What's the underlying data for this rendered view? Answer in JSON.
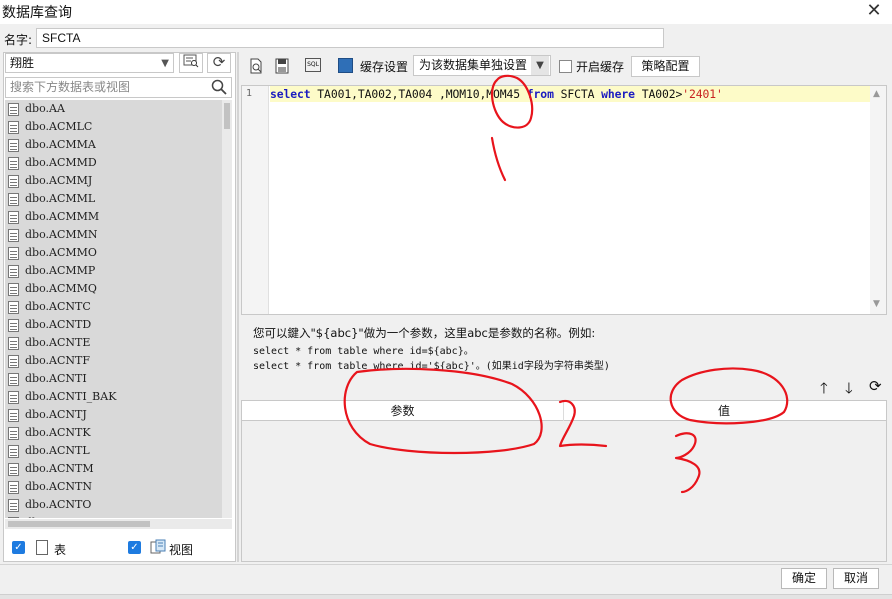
{
  "window": {
    "title": "数据库查询",
    "close_glyph": "✕"
  },
  "name_row": {
    "label": "名字:",
    "value": "SFCTA"
  },
  "left": {
    "datasource": "翔胜",
    "search_placeholder": "搜索下方数据表或视图",
    "tables": [
      "dbo.AA",
      "dbo.ACMLC",
      "dbo.ACMMA",
      "dbo.ACMMD",
      "dbo.ACMMJ",
      "dbo.ACMML",
      "dbo.ACMMM",
      "dbo.ACMMN",
      "dbo.ACMMO",
      "dbo.ACMMP",
      "dbo.ACMMQ",
      "dbo.ACNTC",
      "dbo.ACNTD",
      "dbo.ACNTE",
      "dbo.ACNTF",
      "dbo.ACNTI",
      "dbo.ACNTI_BAK",
      "dbo.ACNTJ",
      "dbo.ACNTK",
      "dbo.ACNTL",
      "dbo.ACNTM",
      "dbo.ACNTN",
      "dbo.ACNTO",
      "dbo.ACNTP"
    ],
    "show_tables_label": "表",
    "show_views_label": "视图"
  },
  "toolbar": {
    "cache_settings_label": "缓存设置",
    "cache_mode": "为该数据集单独设置",
    "enable_cache_label": "开启缓存",
    "strategy_label": "策略配置",
    "sql_icon_text": "SQL"
  },
  "editor": {
    "line_number": "1",
    "tokens": [
      {
        "t": "select",
        "c": "kw"
      },
      {
        "t": " TA001,TA002,TA004 ,MOM10,MOM45 ",
        "c": ""
      },
      {
        "t": "from",
        "c": "kw"
      },
      {
        "t": " SFCTA ",
        "c": ""
      },
      {
        "t": "where",
        "c": "kw"
      },
      {
        "t": " TA002>",
        "c": ""
      },
      {
        "t": "'2401'",
        "c": "str"
      }
    ]
  },
  "help": {
    "line1": "您可以鍵入\"${abc}\"做为一个参数，这里abc是参数的名称。例如:",
    "line2": "select * from table where id=${abc}。",
    "line3": "select * from table where id='${abc}'。(如果id字段为字符串类型)"
  },
  "params": {
    "col_param": "参数",
    "col_value": "值"
  },
  "footer": {
    "ok_label": "确定",
    "cancel_label": "取消"
  },
  "annotations": {
    "color": "#e8141c",
    "marks": [
      "1",
      "2",
      "3"
    ]
  }
}
